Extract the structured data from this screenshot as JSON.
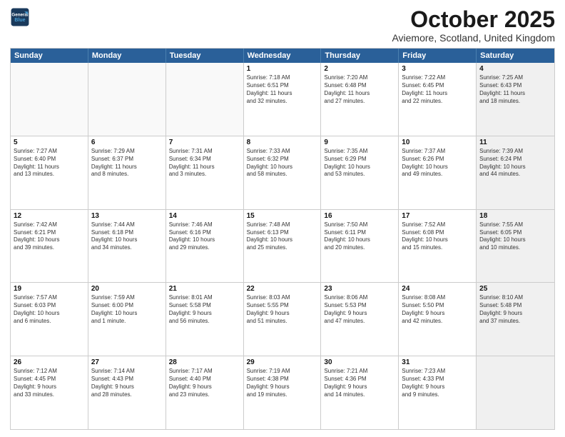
{
  "logo": {
    "line1": "General",
    "line2": "Blue"
  },
  "title": "October 2025",
  "location": "Aviemore, Scotland, United Kingdom",
  "headers": [
    "Sunday",
    "Monday",
    "Tuesday",
    "Wednesday",
    "Thursday",
    "Friday",
    "Saturday"
  ],
  "rows": [
    [
      {
        "day": "",
        "text": "",
        "shaded": false,
        "empty": true
      },
      {
        "day": "",
        "text": "",
        "shaded": false,
        "empty": true
      },
      {
        "day": "",
        "text": "",
        "shaded": false,
        "empty": true
      },
      {
        "day": "1",
        "text": "Sunrise: 7:18 AM\nSunset: 6:51 PM\nDaylight: 11 hours\nand 32 minutes.",
        "shaded": false,
        "empty": false
      },
      {
        "day": "2",
        "text": "Sunrise: 7:20 AM\nSunset: 6:48 PM\nDaylight: 11 hours\nand 27 minutes.",
        "shaded": false,
        "empty": false
      },
      {
        "day": "3",
        "text": "Sunrise: 7:22 AM\nSunset: 6:45 PM\nDaylight: 11 hours\nand 22 minutes.",
        "shaded": false,
        "empty": false
      },
      {
        "day": "4",
        "text": "Sunrise: 7:25 AM\nSunset: 6:43 PM\nDaylight: 11 hours\nand 18 minutes.",
        "shaded": true,
        "empty": false
      }
    ],
    [
      {
        "day": "5",
        "text": "Sunrise: 7:27 AM\nSunset: 6:40 PM\nDaylight: 11 hours\nand 13 minutes.",
        "shaded": false,
        "empty": false
      },
      {
        "day": "6",
        "text": "Sunrise: 7:29 AM\nSunset: 6:37 PM\nDaylight: 11 hours\nand 8 minutes.",
        "shaded": false,
        "empty": false
      },
      {
        "day": "7",
        "text": "Sunrise: 7:31 AM\nSunset: 6:34 PM\nDaylight: 11 hours\nand 3 minutes.",
        "shaded": false,
        "empty": false
      },
      {
        "day": "8",
        "text": "Sunrise: 7:33 AM\nSunset: 6:32 PM\nDaylight: 10 hours\nand 58 minutes.",
        "shaded": false,
        "empty": false
      },
      {
        "day": "9",
        "text": "Sunrise: 7:35 AM\nSunset: 6:29 PM\nDaylight: 10 hours\nand 53 minutes.",
        "shaded": false,
        "empty": false
      },
      {
        "day": "10",
        "text": "Sunrise: 7:37 AM\nSunset: 6:26 PM\nDaylight: 10 hours\nand 49 minutes.",
        "shaded": false,
        "empty": false
      },
      {
        "day": "11",
        "text": "Sunrise: 7:39 AM\nSunset: 6:24 PM\nDaylight: 10 hours\nand 44 minutes.",
        "shaded": true,
        "empty": false
      }
    ],
    [
      {
        "day": "12",
        "text": "Sunrise: 7:42 AM\nSunset: 6:21 PM\nDaylight: 10 hours\nand 39 minutes.",
        "shaded": false,
        "empty": false
      },
      {
        "day": "13",
        "text": "Sunrise: 7:44 AM\nSunset: 6:18 PM\nDaylight: 10 hours\nand 34 minutes.",
        "shaded": false,
        "empty": false
      },
      {
        "day": "14",
        "text": "Sunrise: 7:46 AM\nSunset: 6:16 PM\nDaylight: 10 hours\nand 29 minutes.",
        "shaded": false,
        "empty": false
      },
      {
        "day": "15",
        "text": "Sunrise: 7:48 AM\nSunset: 6:13 PM\nDaylight: 10 hours\nand 25 minutes.",
        "shaded": false,
        "empty": false
      },
      {
        "day": "16",
        "text": "Sunrise: 7:50 AM\nSunset: 6:11 PM\nDaylight: 10 hours\nand 20 minutes.",
        "shaded": false,
        "empty": false
      },
      {
        "day": "17",
        "text": "Sunrise: 7:52 AM\nSunset: 6:08 PM\nDaylight: 10 hours\nand 15 minutes.",
        "shaded": false,
        "empty": false
      },
      {
        "day": "18",
        "text": "Sunrise: 7:55 AM\nSunset: 6:05 PM\nDaylight: 10 hours\nand 10 minutes.",
        "shaded": true,
        "empty": false
      }
    ],
    [
      {
        "day": "19",
        "text": "Sunrise: 7:57 AM\nSunset: 6:03 PM\nDaylight: 10 hours\nand 6 minutes.",
        "shaded": false,
        "empty": false
      },
      {
        "day": "20",
        "text": "Sunrise: 7:59 AM\nSunset: 6:00 PM\nDaylight: 10 hours\nand 1 minute.",
        "shaded": false,
        "empty": false
      },
      {
        "day": "21",
        "text": "Sunrise: 8:01 AM\nSunset: 5:58 PM\nDaylight: 9 hours\nand 56 minutes.",
        "shaded": false,
        "empty": false
      },
      {
        "day": "22",
        "text": "Sunrise: 8:03 AM\nSunset: 5:55 PM\nDaylight: 9 hours\nand 51 minutes.",
        "shaded": false,
        "empty": false
      },
      {
        "day": "23",
        "text": "Sunrise: 8:06 AM\nSunset: 5:53 PM\nDaylight: 9 hours\nand 47 minutes.",
        "shaded": false,
        "empty": false
      },
      {
        "day": "24",
        "text": "Sunrise: 8:08 AM\nSunset: 5:50 PM\nDaylight: 9 hours\nand 42 minutes.",
        "shaded": false,
        "empty": false
      },
      {
        "day": "25",
        "text": "Sunrise: 8:10 AM\nSunset: 5:48 PM\nDaylight: 9 hours\nand 37 minutes.",
        "shaded": true,
        "empty": false
      }
    ],
    [
      {
        "day": "26",
        "text": "Sunrise: 7:12 AM\nSunset: 4:45 PM\nDaylight: 9 hours\nand 33 minutes.",
        "shaded": false,
        "empty": false
      },
      {
        "day": "27",
        "text": "Sunrise: 7:14 AM\nSunset: 4:43 PM\nDaylight: 9 hours\nand 28 minutes.",
        "shaded": false,
        "empty": false
      },
      {
        "day": "28",
        "text": "Sunrise: 7:17 AM\nSunset: 4:40 PM\nDaylight: 9 hours\nand 23 minutes.",
        "shaded": false,
        "empty": false
      },
      {
        "day": "29",
        "text": "Sunrise: 7:19 AM\nSunset: 4:38 PM\nDaylight: 9 hours\nand 19 minutes.",
        "shaded": false,
        "empty": false
      },
      {
        "day": "30",
        "text": "Sunrise: 7:21 AM\nSunset: 4:36 PM\nDaylight: 9 hours\nand 14 minutes.",
        "shaded": false,
        "empty": false
      },
      {
        "day": "31",
        "text": "Sunrise: 7:23 AM\nSunset: 4:33 PM\nDaylight: 9 hours\nand 9 minutes.",
        "shaded": false,
        "empty": false
      },
      {
        "day": "",
        "text": "",
        "shaded": true,
        "empty": true
      }
    ]
  ]
}
